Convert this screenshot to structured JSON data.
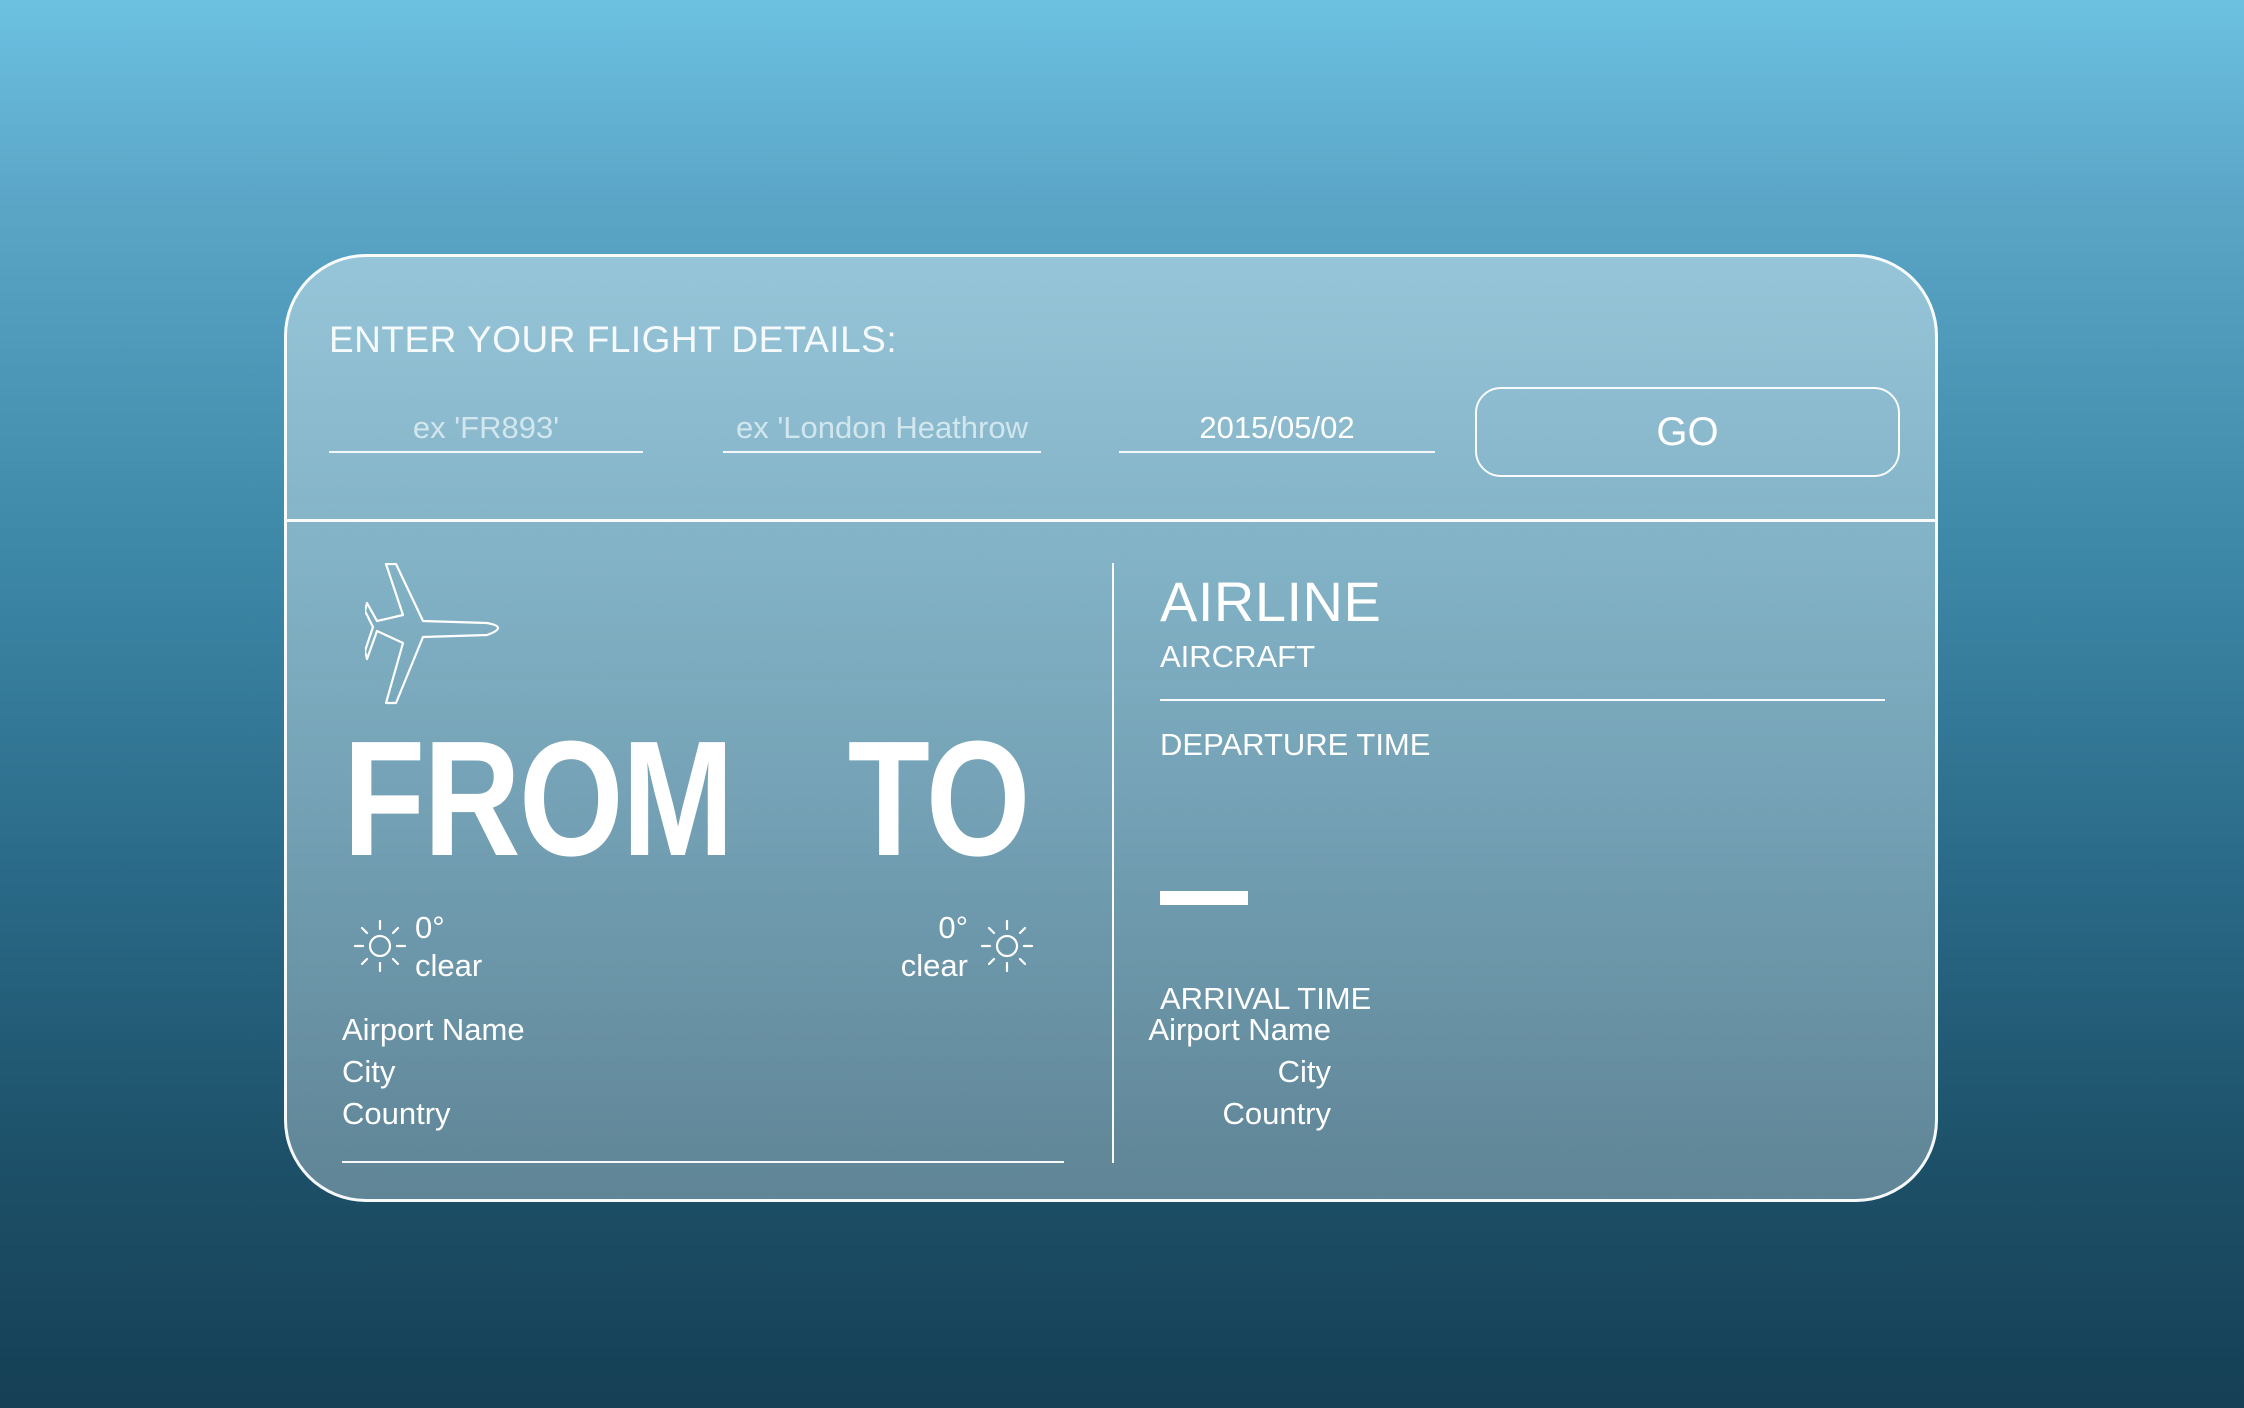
{
  "form": {
    "prompt": "ENTER YOUR FLIGHT DETAILS:",
    "flight_placeholder": "ex 'FR893'",
    "airport_placeholder": "ex 'London Heathrow",
    "date_value": "2015/05/02",
    "go_label": "GO"
  },
  "route": {
    "from_label": "FROM",
    "to_label": "TO",
    "from": {
      "temperature": "0°",
      "condition": "clear",
      "weather_icon": "sun-icon",
      "airport_name": "Airport Name",
      "city": "City",
      "country": "Country"
    },
    "to": {
      "temperature": "0°",
      "condition": "clear",
      "weather_icon": "sun-icon",
      "airport_name": "Airport Name",
      "city": "City",
      "country": "Country"
    }
  },
  "flight_info": {
    "airline": "AIRLINE",
    "aircraft": "AIRCRAFT",
    "departure_label": "DEPARTURE TIME",
    "arrival_label": "ARRIVAL TIME"
  },
  "icons": {
    "plane": "airplane-icon"
  }
}
